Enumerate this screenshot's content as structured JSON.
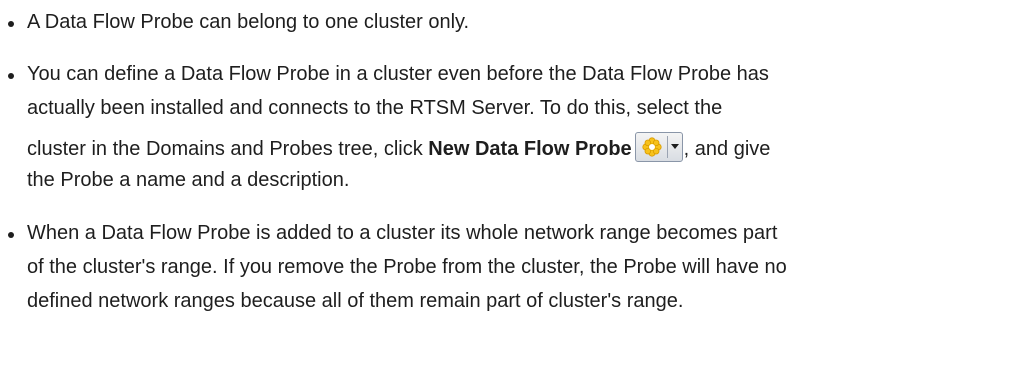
{
  "bullets": [
    {
      "lines": [
        "A Data Flow Probe can belong to one cluster only."
      ]
    },
    {
      "lines": [
        "You can define a Data Flow Probe in a cluster even before the Data Flow Probe has",
        "actually been installed and connects to the RTSM Server. To do this, select the",
        "cluster in the Domains and Probes tree, click ",
        "the Probe a name and a description."
      ],
      "bold_text": "New Data Flow Probe",
      "after_icon": ", and give"
    },
    {
      "lines": [
        "When a Data Flow Probe is added to a cluster its whole network range becomes part",
        "of the cluster's range. If you remove the Probe from the cluster, the Probe will have no",
        "defined network ranges because all of them remain part of cluster's range."
      ]
    }
  ],
  "icons": {
    "new_probe_button": "new-data-flow-probe-icon",
    "dropdown": "chevron-down-icon"
  },
  "colors": {
    "text": "#1e1e1e",
    "icon_star": "#f7c21c",
    "button_border": "#8a96a8"
  }
}
